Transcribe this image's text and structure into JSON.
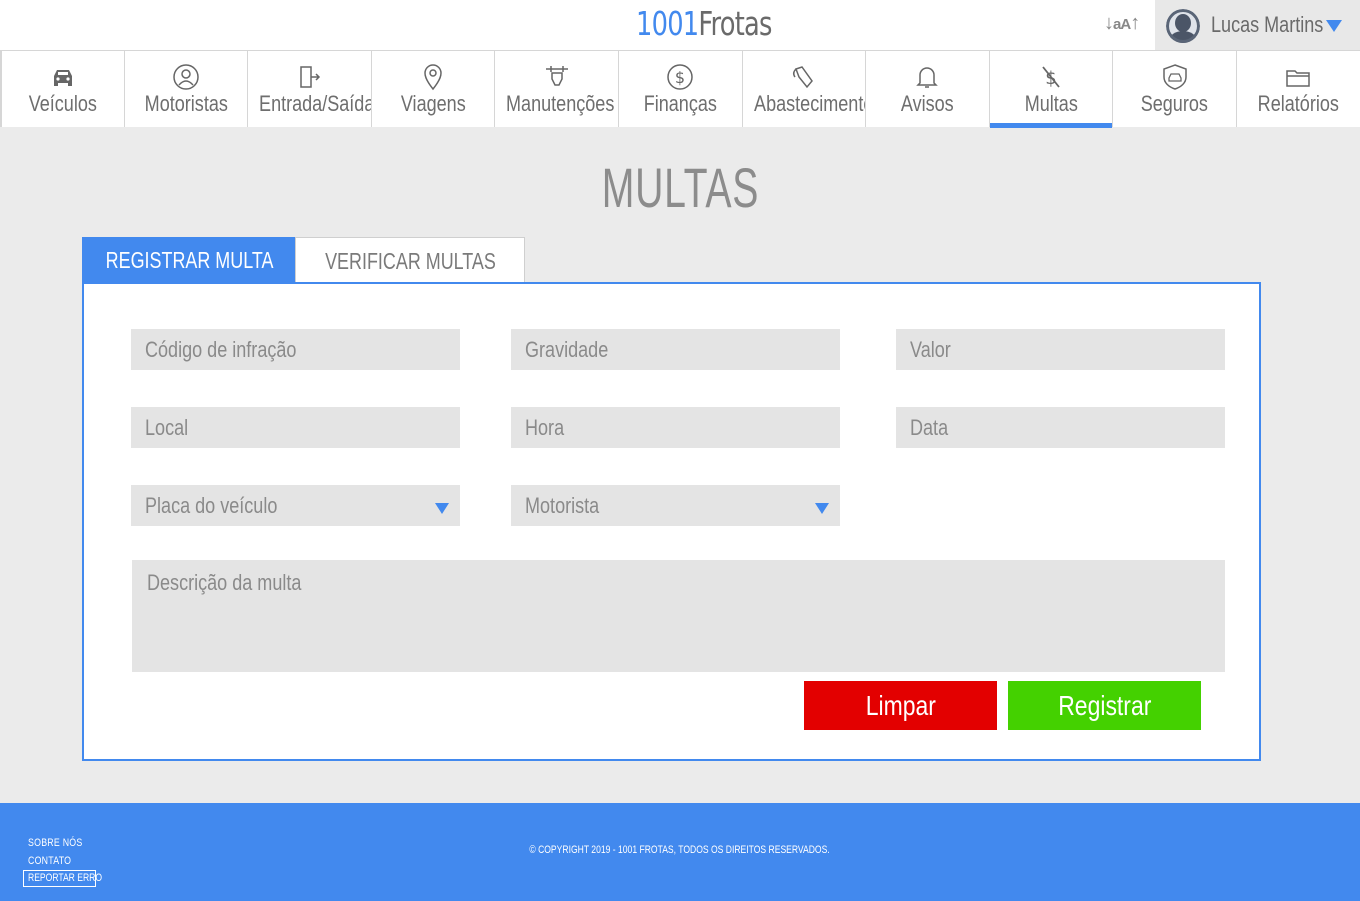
{
  "header": {
    "brand_number": "1001",
    "brand_name": "Frotas",
    "font_size_toggle": "aA",
    "user_name": "Lucas Martins"
  },
  "nav": {
    "items": [
      {
        "label": "Veículos",
        "icon": "car-icon"
      },
      {
        "label": "Motoristas",
        "icon": "driver-icon"
      },
      {
        "label": "Entrada/Saída",
        "icon": "door-exit-icon"
      },
      {
        "label": "Viagens",
        "icon": "map-pin-icon"
      },
      {
        "label": "Manutenções",
        "icon": "wrench-hand-icon"
      },
      {
        "label": "Finanças",
        "icon": "dollar-coin-icon"
      },
      {
        "label": "Abastecimento",
        "icon": "fuel-nozzle-icon"
      },
      {
        "label": "Avisos",
        "icon": "bell-icon"
      },
      {
        "label": "Multas",
        "icon": "dollar-slash-icon",
        "active": true
      },
      {
        "label": "Seguros",
        "icon": "insured-car-icon"
      },
      {
        "label": "Relatórios",
        "icon": "folder-icon"
      }
    ],
    "active_color": "#4289ee"
  },
  "page": {
    "title": "MULTAS",
    "tabs": {
      "register": "REGISTRAR MULTA",
      "verify": "VERIFICAR MULTAS"
    }
  },
  "form": {
    "infraction_code": "Código de infração",
    "severity": "Gravidade",
    "value": "Valor",
    "location": "Local",
    "time": "Hora",
    "date": "Data",
    "vehicle_plate": "Placa do veículo",
    "driver": "Motorista",
    "description": "Descrição da multa",
    "clear_label": "Limpar",
    "submit_label": "Registrar"
  },
  "footer": {
    "about": "SOBRE NÓS",
    "contact": "CONTATO",
    "report": "REPORTAR ERRO",
    "copyright": "© COPYRIGHT 2019 - 1001 FROTAS, TODOS OS DIREITOS RESERVADOS."
  },
  "colors": {
    "accent": "#4289ee",
    "clear": "#e30000",
    "submit": "#44d100"
  }
}
